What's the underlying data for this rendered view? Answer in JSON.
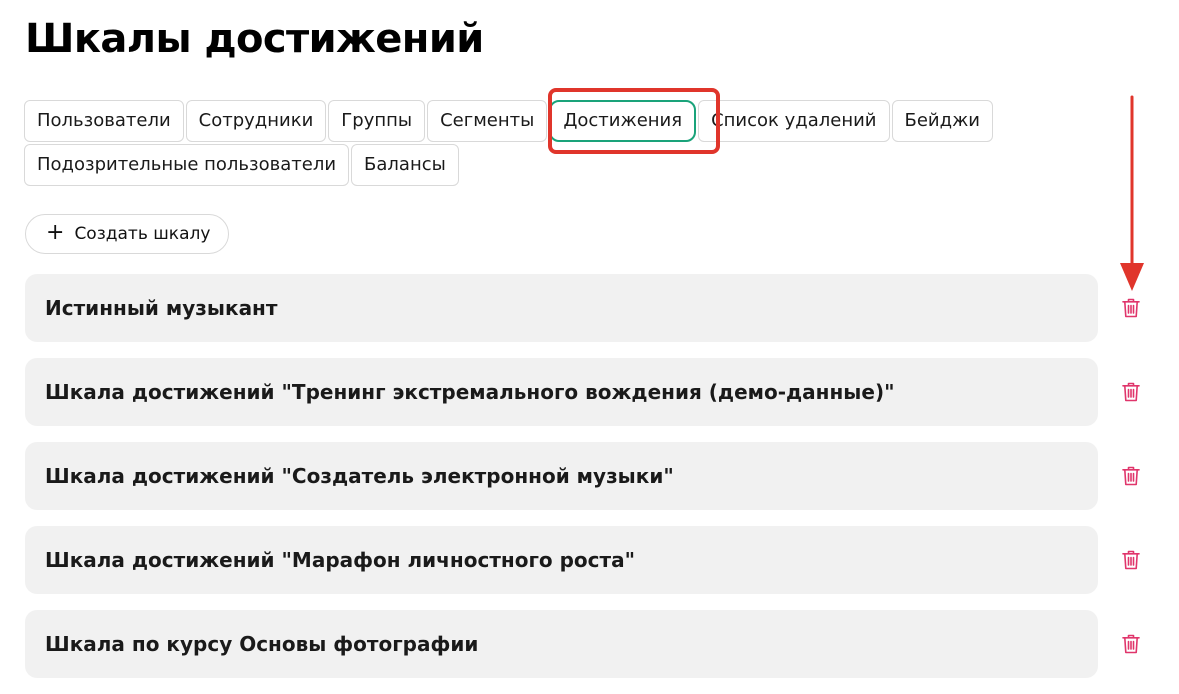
{
  "page": {
    "title": "Шкалы достижений"
  },
  "tabs": {
    "row1": [
      {
        "label": "Пользователи"
      },
      {
        "label": "Сотрудники"
      },
      {
        "label": "Группы"
      },
      {
        "label": "Сегменты"
      },
      {
        "label": "Достижения",
        "active": true
      },
      {
        "label": "Список удалений"
      },
      {
        "label": "Бейджи"
      }
    ],
    "row2": [
      {
        "label": "Подозрительные пользователи"
      },
      {
        "label": "Балансы"
      }
    ]
  },
  "actions": {
    "create_label": "Создать шкалу",
    "create_icon": "plus-icon"
  },
  "scales": [
    {
      "title": "Истинный музыкант"
    },
    {
      "title": "Шкала достижений \"Тренинг экстремального вождения (демо-данные)\""
    },
    {
      "title": "Шкала достижений \"Создатель электронной музыки\""
    },
    {
      "title": "Шкала достижений \"Марафон личностного роста\""
    },
    {
      "title": "Шкала по курсу Основы фотографии"
    }
  ],
  "colors": {
    "accent": "#1aa37a",
    "delete": "#e0356b",
    "annotation": "#e0352b",
    "card_bg": "#f1f1f1"
  },
  "icons": {
    "delete": "trash-icon",
    "annotation_arrow": "arrow-down-icon"
  }
}
